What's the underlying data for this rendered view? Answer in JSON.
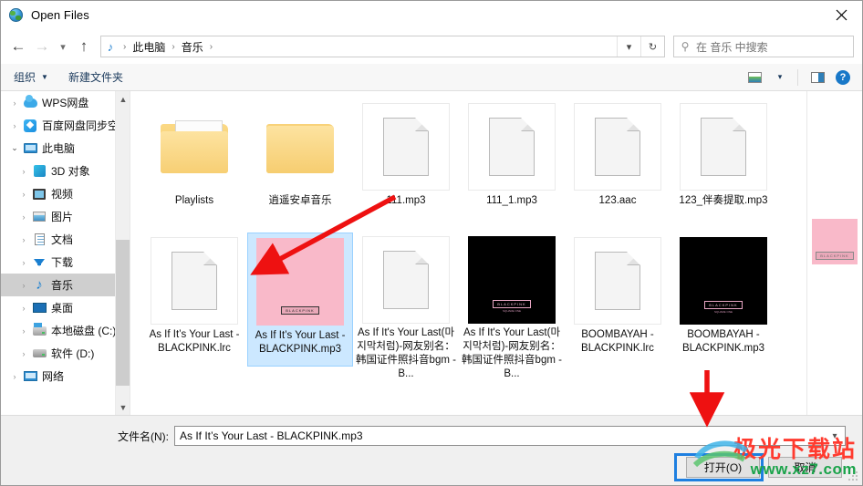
{
  "window": {
    "title": "Open Files",
    "title_icon": "globe-icon",
    "close_icon": "close-icon"
  },
  "nav": {
    "back_icon": "arrow-left-icon",
    "forward_icon": "arrow-right-icon",
    "recent_icon": "chevron-down-icon",
    "up_icon": "arrow-up-icon",
    "address_icon": "music-note-icon",
    "crumbs": [
      "此电脑",
      "音乐"
    ],
    "separator": "›",
    "dropdown_icon": "chevron-down-icon",
    "refresh_icon": "refresh-icon"
  },
  "search": {
    "icon": "search-icon",
    "placeholder": "在 音乐 中搜索"
  },
  "toolbar": {
    "organize_label": "组织",
    "new_folder_label": "新建文件夹",
    "caret": "▼",
    "view_icon": "view-options-icon",
    "view_caret_icon": "chevron-down-icon",
    "preview_pane_icon": "preview-pane-icon",
    "help_icon": "help-icon",
    "help_glyph": "?"
  },
  "sidebar": {
    "items": [
      {
        "label": "WPS网盘",
        "icon": "cloud-icon",
        "chevron": "›",
        "indent": false,
        "selected": false,
        "expanded": false
      },
      {
        "label": "百度网盘同步空间",
        "icon": "baidu-netdisk-icon",
        "chevron": "›",
        "indent": false,
        "selected": false,
        "expanded": false
      },
      {
        "label": "此电脑",
        "icon": "this-pc-icon",
        "chevron": "⌄",
        "indent": false,
        "selected": false,
        "expanded": true
      },
      {
        "label": "3D 对象",
        "icon": "3d-objects-icon",
        "chevron": "›",
        "indent": true,
        "selected": false,
        "expanded": false
      },
      {
        "label": "视频",
        "icon": "videos-icon",
        "chevron": "›",
        "indent": true,
        "selected": false,
        "expanded": false
      },
      {
        "label": "图片",
        "icon": "pictures-icon",
        "chevron": "›",
        "indent": true,
        "selected": false,
        "expanded": false
      },
      {
        "label": "文档",
        "icon": "documents-icon",
        "chevron": "›",
        "indent": true,
        "selected": false,
        "expanded": false
      },
      {
        "label": "下载",
        "icon": "downloads-icon",
        "chevron": "›",
        "indent": true,
        "selected": false,
        "expanded": false
      },
      {
        "label": "音乐",
        "icon": "music-icon",
        "chevron": "›",
        "indent": true,
        "selected": true,
        "expanded": false
      },
      {
        "label": "桌面",
        "icon": "desktop-icon",
        "chevron": "›",
        "indent": true,
        "selected": false,
        "expanded": false
      },
      {
        "label": "本地磁盘 (C:)",
        "icon": "disk-c-icon",
        "chevron": "›",
        "indent": true,
        "selected": false,
        "expanded": false
      },
      {
        "label": "软件 (D:)",
        "icon": "disk-d-icon",
        "chevron": "›",
        "indent": true,
        "selected": false,
        "expanded": false
      },
      {
        "label": "网络",
        "icon": "network-icon",
        "chevron": "›",
        "indent": false,
        "selected": false,
        "expanded": false
      }
    ],
    "scroll_up_icon": "chevron-up-icon",
    "scroll_down_icon": "chevron-down-icon"
  },
  "files": [
    {
      "name": "Playlists",
      "kind": "folder-open",
      "selected": false
    },
    {
      "name": "逍遥安卓音乐",
      "kind": "folder-closed",
      "selected": false
    },
    {
      "name": "111.mp3",
      "kind": "document",
      "selected": false
    },
    {
      "name": "111_1.mp3",
      "kind": "document",
      "selected": false
    },
    {
      "name": "123.aac",
      "kind": "document",
      "selected": false
    },
    {
      "name": "123_伴奏提取.mp3",
      "kind": "document",
      "selected": false
    },
    {
      "name": "As If It’s Your Last - BLACKPINK.lrc",
      "kind": "document",
      "selected": false
    },
    {
      "name": "As If It’s Your Last - BLACKPINK.mp3",
      "kind": "cover-pink",
      "selected": true
    },
    {
      "name": "As If It's Your Last(마지막처럼)-网友别名：韩国证件照抖音bgm - B...",
      "kind": "document",
      "selected": false
    },
    {
      "name": "As If It's Your Last(마지막처럼)-网友别名：韩国证件照抖音bgm - B...",
      "kind": "cover-black",
      "selected": false
    },
    {
      "name": "BOOMBAYAH - BLACKPINK.lrc",
      "kind": "document",
      "selected": false
    },
    {
      "name": "BOOMBAYAH - BLACKPINK.mp3",
      "kind": "cover-black",
      "selected": false
    }
  ],
  "cover_art": {
    "logo_text": "BLACKPINK",
    "sub_text": "SQUARE ONE"
  },
  "footer": {
    "filename_label": "文件名(N):",
    "filename_value": "As If It’s Your Last - BLACKPINK.mp3",
    "filename_dropdown_icon": "chevron-down-icon",
    "open_button": "打开(O)",
    "cancel_button": "取消",
    "resize_grip_icon": "resize-grip-icon"
  },
  "annotations": {
    "highlight_color": "#1e7fe0",
    "arrow_color": "#ee1111",
    "arrow_count": 2
  },
  "watermark": {
    "top_text": "极光下载站",
    "bottom_text": "www.xz7.com",
    "top_color": "#ff3b2f",
    "bottom_color": "#1aa34a"
  }
}
